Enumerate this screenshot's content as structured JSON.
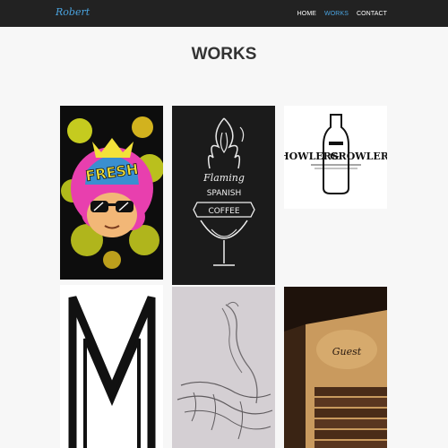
{
  "navbar": {
    "brand": "Robert",
    "links": [
      {
        "label": "HOME",
        "active": false
      },
      {
        "label": "WORKS",
        "active": true
      },
      {
        "label": "CONTACT",
        "active": false
      }
    ]
  },
  "page": {
    "title": "WORKS"
  },
  "works": [
    {
      "name": "fresh-artwork",
      "text": "FRESH"
    },
    {
      "name": "flaming-spanish-coffee",
      "text": [
        "Flaming",
        "SPANISH",
        "COFFEE"
      ]
    },
    {
      "name": "howlers-growlers",
      "text": [
        "HOWLERS",
        "&",
        "GROWLERS"
      ]
    },
    {
      "name": "m-logo",
      "text": ""
    },
    {
      "name": "sketch-artwork",
      "text": ""
    },
    {
      "name": "guest-wall-mural",
      "text": "Guest"
    }
  ],
  "colors": {
    "navbar_bg": "#222222",
    "accent": "#4aa3df",
    "page_bg": "#f7f7f7",
    "title": "#333333"
  }
}
